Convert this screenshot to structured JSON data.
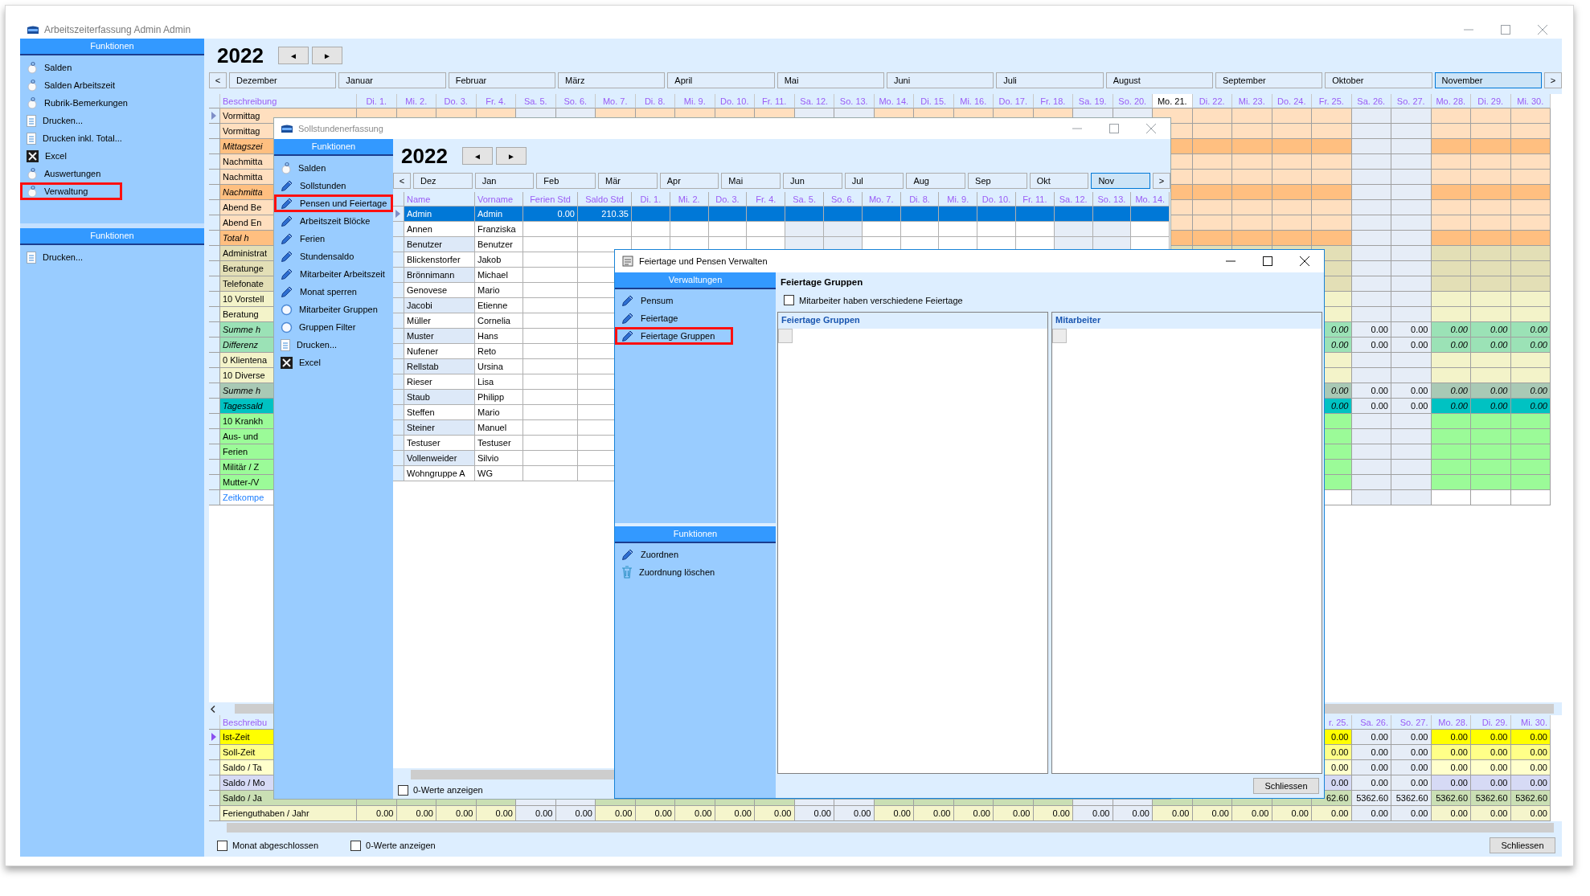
{
  "main_window": {
    "title": "Arbeitszeiterfassung Admin Admin",
    "sidebar": [
      {
        "header": "Funktionen",
        "items": [
          {
            "label": "Salden",
            "kind": "round",
            "highlighted": false
          },
          {
            "label": "Salden Arbeitszeit",
            "kind": "round",
            "highlighted": false
          },
          {
            "label": "Rubrik-Bemerkungen",
            "kind": "round",
            "highlighted": false
          },
          {
            "label": "Drucken...",
            "kind": "document",
            "highlighted": false
          },
          {
            "label": "Drucken inkl. Total...",
            "kind": "document",
            "highlighted": false
          },
          {
            "label": "Excel",
            "kind": "spreadsheet",
            "highlighted": false
          },
          {
            "label": "Auswertungen",
            "kind": "round",
            "highlighted": false
          },
          {
            "label": "Verwaltung",
            "kind": "round",
            "highlighted": true
          }
        ]
      },
      {
        "header": "Funktionen",
        "items": [
          {
            "label": "Drucken...",
            "kind": "document",
            "highlighted": false
          }
        ]
      }
    ],
    "year": "2022",
    "prev": "◄",
    "next": "►",
    "months": {
      "prev": "<",
      "next": ">",
      "items": [
        {
          "label": "Dezember",
          "selected": false
        },
        {
          "label": "Januar",
          "selected": false
        },
        {
          "label": "Februar",
          "selected": false
        },
        {
          "label": "März",
          "selected": false
        },
        {
          "label": "April",
          "selected": false
        },
        {
          "label": "Mai",
          "selected": false
        },
        {
          "label": "Juni",
          "selected": false
        },
        {
          "label": "Juli",
          "selected": false
        },
        {
          "label": "August",
          "selected": false
        },
        {
          "label": "September",
          "selected": false
        },
        {
          "label": "Oktober",
          "selected": false
        },
        {
          "label": "November",
          "selected": true
        }
      ]
    },
    "grid": {
      "label_header": "Beschreibung",
      "days": [
        {
          "label": "Di. 1.",
          "weekend": false,
          "today": false
        },
        {
          "label": "Mi. 2.",
          "weekend": false,
          "today": false
        },
        {
          "label": "Do. 3.",
          "weekend": false,
          "today": false
        },
        {
          "label": "Fr. 4.",
          "weekend": false,
          "today": false
        },
        {
          "label": "Sa. 5.",
          "weekend": true,
          "today": false
        },
        {
          "label": "So. 6.",
          "weekend": true,
          "today": false
        },
        {
          "label": "Mo. 7.",
          "weekend": false,
          "today": false
        },
        {
          "label": "Di. 8.",
          "weekend": false,
          "today": false
        },
        {
          "label": "Mi. 9.",
          "weekend": false,
          "today": false
        },
        {
          "label": "Do. 10.",
          "weekend": false,
          "today": false
        },
        {
          "label": "Fr. 11.",
          "weekend": false,
          "today": false
        },
        {
          "label": "Sa. 12.",
          "weekend": true,
          "today": false
        },
        {
          "label": "So. 13.",
          "weekend": true,
          "today": false
        },
        {
          "label": "Mo. 14.",
          "weekend": false,
          "today": false
        },
        {
          "label": "Di. 15.",
          "weekend": false,
          "today": false
        },
        {
          "label": "Mi. 16.",
          "weekend": false,
          "today": false
        },
        {
          "label": "Do. 17.",
          "weekend": false,
          "today": false
        },
        {
          "label": "Fr. 18.",
          "weekend": false,
          "today": false
        },
        {
          "label": "Sa. 19.",
          "weekend": true,
          "today": false
        },
        {
          "label": "So. 20.",
          "weekend": true,
          "today": false
        },
        {
          "label": "Mo. 21.",
          "weekend": false,
          "today": true
        },
        {
          "label": "Di. 22.",
          "weekend": false,
          "today": false
        },
        {
          "label": "Mi. 23.",
          "weekend": false,
          "today": false
        },
        {
          "label": "Do. 24.",
          "weekend": false,
          "today": false
        },
        {
          "label": "Fr. 25.",
          "weekend": false,
          "today": false
        },
        {
          "label": "Sa. 26.",
          "weekend": true,
          "today": false
        },
        {
          "label": "So. 27.",
          "weekend": true,
          "today": false
        },
        {
          "label": "Mo. 28.",
          "weekend": false,
          "today": false
        },
        {
          "label": "Di. 29.",
          "weekend": false,
          "today": false
        },
        {
          "label": "Mi. 30.",
          "weekend": false,
          "today": false
        }
      ],
      "rows": [
        {
          "label": "Vormittag",
          "kind": "shift",
          "current": true
        },
        {
          "label": "Vormittag",
          "kind": "shift",
          "current": false
        },
        {
          "label": "Mittagszei",
          "kind": "break",
          "current": false
        },
        {
          "label": "Nachmitta",
          "kind": "shift",
          "current": false
        },
        {
          "label": "Nachmitta",
          "kind": "shift",
          "current": false
        },
        {
          "label": "Nachmitta",
          "kind": "break",
          "current": false
        },
        {
          "label": "Abend Be",
          "kind": "shift",
          "current": false
        },
        {
          "label": "Abend En",
          "kind": "shift",
          "current": false
        },
        {
          "label": "Total h",
          "kind": "break",
          "current": false
        },
        {
          "label": "Administrat",
          "kind": "activity",
          "current": false
        },
        {
          "label": "Beratunge",
          "kind": "activity",
          "current": false
        },
        {
          "label": "Telefonate",
          "kind": "activity",
          "current": false
        },
        {
          "label": "10 Vorstell",
          "kind": "client",
          "current": false
        },
        {
          "label": "Beratung",
          "kind": "client",
          "current": false
        },
        {
          "label": "Summe h",
          "kind": "sum",
          "current": false,
          "values": [
            "0.00",
            "0.00",
            "0.00",
            "0.00",
            "0.00",
            "0.00"
          ]
        },
        {
          "label": "Differenz",
          "kind": "sum",
          "current": false,
          "values": [
            "0.00",
            "0.00",
            "0.00",
            "0.00",
            "0.00",
            "0.00"
          ]
        },
        {
          "label": "0 Klientena",
          "kind": "client",
          "current": false
        },
        {
          "label": "10 Diverse",
          "kind": "client",
          "current": false
        },
        {
          "label": "Summe h",
          "kind": "subtotal",
          "current": false,
          "values": [
            "0.00",
            "0.00",
            "0.00",
            "0.00",
            "0.00",
            "0.00"
          ]
        },
        {
          "label": "Tagessald",
          "kind": "balance",
          "current": false,
          "values": [
            "0.00",
            "0.00",
            "0.00",
            "0.00",
            "0.00",
            "0.00"
          ]
        },
        {
          "label": "10 Krankh",
          "kind": "absence",
          "current": false
        },
        {
          "label": "Aus- und",
          "kind": "absence",
          "current": false
        },
        {
          "label": "Ferien",
          "kind": "absence",
          "current": false
        },
        {
          "label": "Militär / Z",
          "kind": "absence",
          "current": false
        },
        {
          "label": "Mutter-/V",
          "kind": "absence",
          "current": false
        },
        {
          "label": "Zeitkompe",
          "kind": "link",
          "current": false
        }
      ]
    },
    "summary_grid": {
      "label_header": "Beschreibu",
      "days": [
        "r. 25.",
        "Sa. 26.",
        "So. 27.",
        "Mo. 28.",
        "Di. 29.",
        "Mi. 30."
      ],
      "rows": [
        {
          "label": "Ist-Zeit",
          "kind": "actual",
          "current": true,
          "values": [
            "0.00",
            "0.00",
            "0.00",
            "0.00",
            "0.00",
            "0.00"
          ]
        },
        {
          "label": "Soll-Zeit",
          "kind": "target",
          "current": false,
          "values": [
            "0.00",
            "0.00",
            "0.00",
            "0.00",
            "0.00",
            "0.00"
          ]
        },
        {
          "label": "Saldo / Ta",
          "kind": "day-balance",
          "current": false,
          "values": [
            "0.00",
            "0.00",
            "0.00",
            "0.00",
            "0.00",
            "0.00"
          ]
        },
        {
          "label": "Saldo / Mo",
          "kind": "month-balance",
          "current": false,
          "values": [
            "0.00",
            "0.00",
            "0.00",
            "0.00",
            "0.00",
            "0.00"
          ]
        },
        {
          "label": "Saldo / Ja",
          "kind": "year-balance",
          "current": false,
          "values": [
            "62.60",
            "5362.60",
            "5362.60",
            "5362.60",
            "5362.60",
            "5362.60"
          ]
        },
        {
          "label": "Ferienguthaben / Jahr",
          "kind": "vacation",
          "current": false,
          "values": [
            "0.00",
            "0.00",
            "0.00",
            "0.00",
            "0.00",
            "0.00",
            "0.00",
            "0.00",
            "0.00",
            "0.00",
            "0.00",
            "0.00",
            "0.00",
            "0.00",
            "0.00",
            "0.00",
            "0.00",
            "0.00",
            "0.00",
            "0.00",
            "0.00",
            "0.00",
            "0.00",
            "0.00",
            "0.00",
            "0.00",
            "0.00",
            "0.00",
            "0.00",
            "0.00"
          ]
        }
      ]
    },
    "footer": {
      "checkboxes": [
        {
          "label": "Monat abgeschlossen",
          "checked": false
        },
        {
          "label": "0-Werte anzeigen",
          "checked": false
        }
      ],
      "close_button": "Schliessen"
    }
  },
  "sollstunden_window": {
    "title": "Sollstundenerfassung",
    "sidebar": {
      "header": "Funktionen",
      "items": [
        {
          "label": "Salden",
          "kind": "round",
          "highlighted": false
        },
        {
          "label": "Sollstunden",
          "kind": "pencil",
          "highlighted": false
        },
        {
          "label": "Pensen und Feiertage",
          "kind": "pencil",
          "highlighted": true
        },
        {
          "label": "Arbeitszeit Blöcke",
          "kind": "pencil",
          "highlighted": false
        },
        {
          "label": "Ferien",
          "kind": "pencil",
          "highlighted": false
        },
        {
          "label": "Stundensaldo",
          "kind": "pencil",
          "highlighted": false
        },
        {
          "label": "Mitarbeiter Arbeitszeit",
          "kind": "pencil",
          "highlighted": false
        },
        {
          "label": "Monat sperren",
          "kind": "pencil",
          "highlighted": false
        },
        {
          "label": "Mitarbeiter Gruppen",
          "kind": "ring",
          "highlighted": false
        },
        {
          "label": "Gruppen Filter",
          "kind": "ring",
          "highlighted": false
        },
        {
          "label": "Drucken...",
          "kind": "document",
          "highlighted": false
        },
        {
          "label": "Excel",
          "kind": "spreadsheet",
          "highlighted": false
        }
      ]
    },
    "year": "2022",
    "prev": "◄",
    "next": "►",
    "months": {
      "prev": "<",
      "next": ">",
      "items": [
        {
          "label": "Dez",
          "selected": false
        },
        {
          "label": "Jan",
          "selected": false
        },
        {
          "label": "Feb",
          "selected": false
        },
        {
          "label": "Mär",
          "selected": false
        },
        {
          "label": "Apr",
          "selected": false
        },
        {
          "label": "Mai",
          "selected": false
        },
        {
          "label": "Jun",
          "selected": false
        },
        {
          "label": "Jul",
          "selected": false
        },
        {
          "label": "Aug",
          "selected": false
        },
        {
          "label": "Sep",
          "selected": false
        },
        {
          "label": "Okt",
          "selected": false
        },
        {
          "label": "Nov",
          "selected": true
        }
      ]
    },
    "table": {
      "columns": [
        "Name",
        "Vorname",
        "Ferien Std",
        "Saldo Std"
      ],
      "days": [
        {
          "label": "Di. 1.",
          "weekend": false
        },
        {
          "label": "Mi. 2.",
          "weekend": false
        },
        {
          "label": "Do. 3.",
          "weekend": false
        },
        {
          "label": "Fr. 4.",
          "weekend": false
        },
        {
          "label": "Sa. 5.",
          "weekend": true
        },
        {
          "label": "So. 6.",
          "weekend": true
        },
        {
          "label": "Mo. 7.",
          "weekend": false
        },
        {
          "label": "Di. 8.",
          "weekend": false
        },
        {
          "label": "Mi. 9.",
          "weekend": false
        },
        {
          "label": "Do. 10.",
          "weekend": false
        },
        {
          "label": "Fr. 11.",
          "weekend": false
        },
        {
          "label": "Sa. 12.",
          "weekend": true
        },
        {
          "label": "So. 13.",
          "weekend": true
        },
        {
          "label": "Mo. 14.",
          "weekend": false
        }
      ],
      "rows": [
        {
          "name": "Admin",
          "first_name": "Admin",
          "vacation": "0.00",
          "balance": "210.35",
          "selected": true
        },
        {
          "name": "Annen",
          "first_name": "Franziska",
          "selected": false
        },
        {
          "name": "Benutzer",
          "first_name": "Benutzer",
          "selected": false
        },
        {
          "name": "Blickenstorfer",
          "first_name": "Jakob",
          "selected": false
        },
        {
          "name": "Brönnimann",
          "first_name": "Michael",
          "selected": false
        },
        {
          "name": "Genovese",
          "first_name": "Mario",
          "selected": false
        },
        {
          "name": "Jacobi",
          "first_name": "Etienne",
          "selected": false
        },
        {
          "name": "Müller",
          "first_name": "Cornelia",
          "selected": false
        },
        {
          "name": "Muster",
          "first_name": "Hans",
          "selected": false
        },
        {
          "name": "Nufener",
          "first_name": "Reto",
          "selected": false
        },
        {
          "name": "Rellstab",
          "first_name": "Ursina",
          "selected": false
        },
        {
          "name": "Rieser",
          "first_name": "Lisa",
          "selected": false
        },
        {
          "name": "Staub",
          "first_name": "Philipp",
          "selected": false
        },
        {
          "name": "Steffen",
          "first_name": "Mario",
          "selected": false
        },
        {
          "name": "Steiner",
          "first_name": "Manuel",
          "selected": false
        },
        {
          "name": "Testuser",
          "first_name": "Testuser",
          "selected": false
        },
        {
          "name": "Vollenweider",
          "first_name": "Silvio",
          "selected": false
        },
        {
          "name": "Wohngruppe A",
          "first_name": "WG",
          "selected": false
        }
      ]
    },
    "zero_values": {
      "label": "0-Werte anzeigen",
      "checked": false
    }
  },
  "feiertage_window": {
    "title": "Feiertage und Pensen Verwalten",
    "sidebar": [
      {
        "header": "Verwaltungen",
        "items": [
          {
            "label": "Pensum",
            "kind": "pencil",
            "highlighted": false
          },
          {
            "label": "Feiertage",
            "kind": "pencil",
            "highlighted": false
          },
          {
            "label": "Feiertage Gruppen",
            "kind": "pencil",
            "highlighted": true
          }
        ]
      },
      {
        "header": "Funktionen",
        "items": [
          {
            "label": "Zuordnen",
            "kind": "pencil",
            "highlighted": false
          },
          {
            "label": "Zuordnung löschen",
            "kind": "trash",
            "highlighted": false
          }
        ]
      }
    ],
    "heading": "Feiertage Gruppen",
    "option": {
      "label": "Mitarbeiter haben verschiedene Feiertage",
      "checked": false
    },
    "panels": [
      {
        "title": "Feiertage Gruppen"
      },
      {
        "title": "Mitarbeiter"
      }
    ],
    "close_button": "Schliessen"
  }
}
